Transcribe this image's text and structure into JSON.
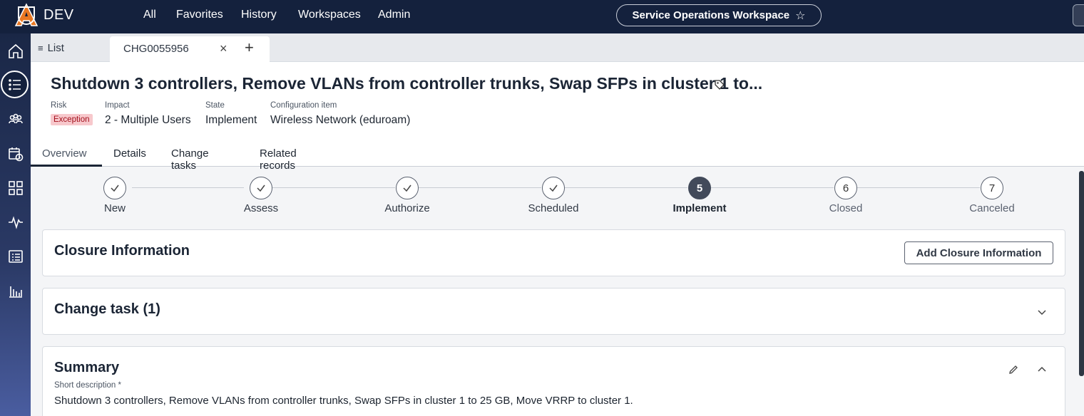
{
  "app": {
    "brand": "DEV"
  },
  "nav": {
    "items": [
      "All",
      "Favorites",
      "History",
      "Workspaces",
      "Admin"
    ],
    "workspace_label": "Service Operations Workspace"
  },
  "tabs_strip": {
    "list_label": "List",
    "doc_tab": "CHG0055956"
  },
  "record": {
    "title": "Shutdown 3 controllers, Remove VLANs from controller trunks, Swap SFPs in cluster 1 to...",
    "risk_label": "Risk",
    "risk_value": "Exception",
    "impact_label": "Impact",
    "impact_value": "2 - Multiple Users",
    "state_label": "State",
    "state_value": "Implement",
    "ci_label": "Configuration item",
    "ci_value": "Wireless Network (eduroam)"
  },
  "record_tabs": [
    "Overview",
    "Details",
    "Change tasks",
    "Related records"
  ],
  "stepper": {
    "steps": [
      {
        "label": "New",
        "status": "done",
        "num": ""
      },
      {
        "label": "Assess",
        "status": "done",
        "num": ""
      },
      {
        "label": "Authorize",
        "status": "done",
        "num": ""
      },
      {
        "label": "Scheduled",
        "status": "done",
        "num": ""
      },
      {
        "label": "Implement",
        "status": "current",
        "num": "5"
      },
      {
        "label": "Closed",
        "status": "future",
        "num": "6"
      },
      {
        "label": "Canceled",
        "status": "future",
        "num": "7"
      }
    ]
  },
  "closure": {
    "title": "Closure Information",
    "button": "Add Closure Information"
  },
  "change_task": {
    "title": "Change task (1)"
  },
  "summary": {
    "title": "Summary",
    "field_label": "Short description *",
    "field_value": "Shutdown 3 controllers, Remove VLANs from controller trunks, Swap SFPs in cluster 1 to 25 GB, Move VRRP to cluster 1."
  },
  "colors": {
    "nav_bg": "#14213d",
    "risk_badge_bg": "#f7c8cc",
    "link": "#1866a8",
    "current_step": "#424a5a"
  }
}
